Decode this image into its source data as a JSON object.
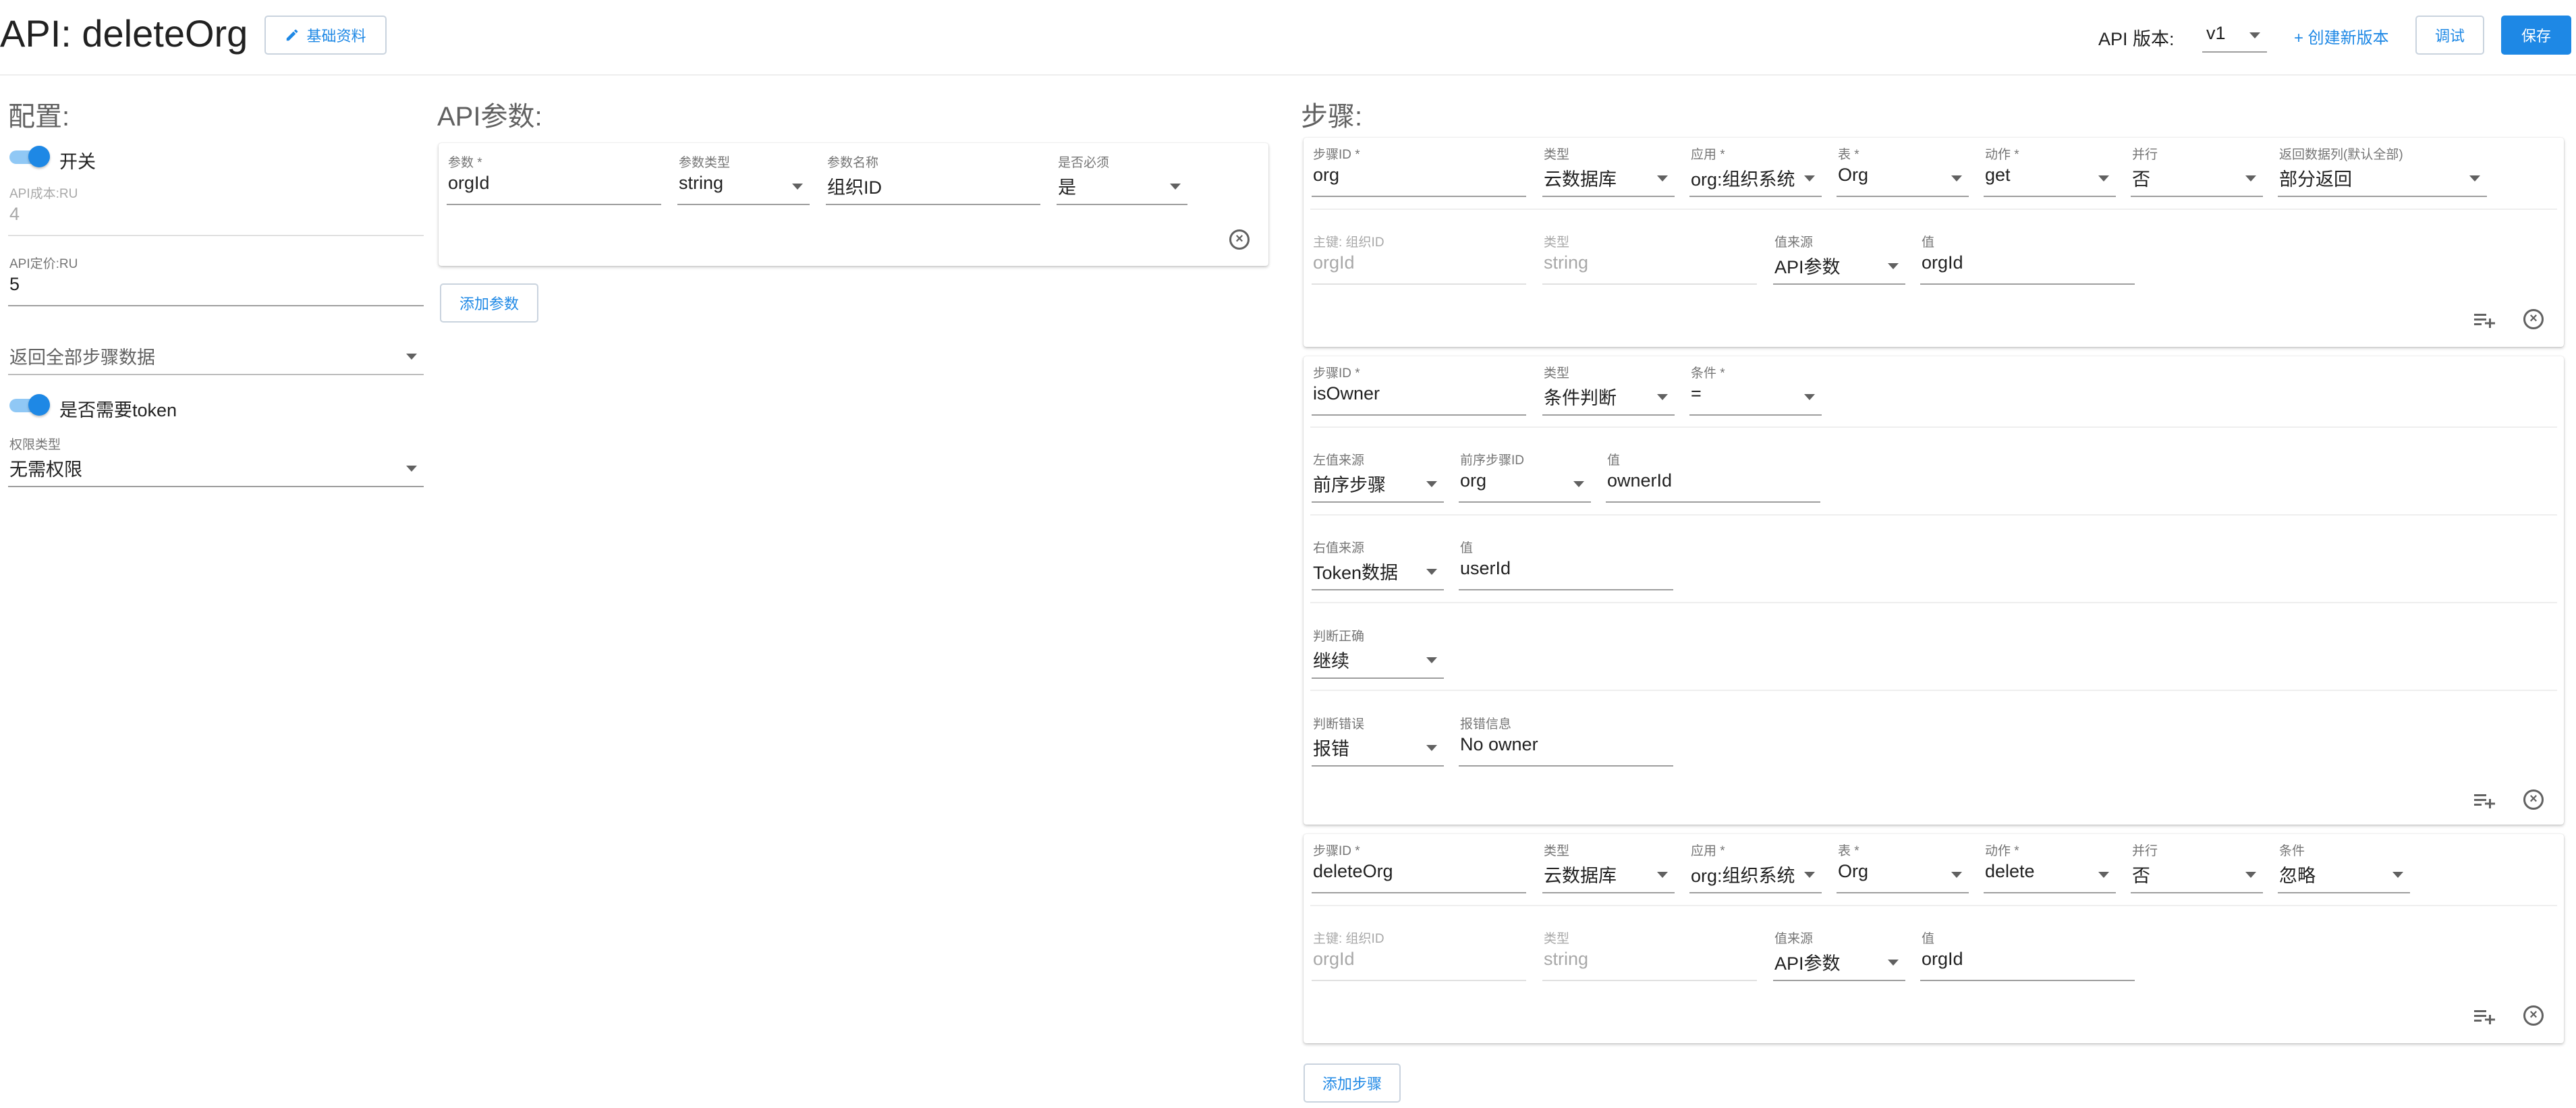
{
  "header": {
    "title": "API: deleteOrg",
    "edit_button": "基础资料",
    "version_label": "API 版本:",
    "version_value": "v1",
    "create_version": "+ 创建新版本",
    "debug_button": "调试",
    "save_button": "保存"
  },
  "config": {
    "title": "配置:",
    "switch_label": "开关",
    "cost_label": "API成本:RU",
    "cost_value": "4",
    "price_label": "API定价:RU",
    "price_value": "5",
    "return_select": "返回全部步骤数据",
    "token_label": "是否需要token",
    "perm_label": "权限类型",
    "perm_value": "无需权限"
  },
  "params": {
    "title": "API参数:",
    "headers": {
      "name": "参数 *",
      "type": "参数类型",
      "label": "参数名称",
      "required": "是否必须"
    },
    "rows": [
      {
        "name": "orgId",
        "type": "string",
        "label": "组织ID",
        "required": "是"
      }
    ],
    "add_button": "添加参数"
  },
  "steps": {
    "title": "步骤:",
    "step1": {
      "labels": {
        "id": "步骤ID *",
        "type": "类型",
        "app": "应用 *",
        "table": "表 *",
        "action": "动作 *",
        "parallel": "并行",
        "columns": "返回数据列(默认全部)"
      },
      "values": {
        "id": "org",
        "type": "云数据库",
        "app": "org:组织系统",
        "table": "Org",
        "action": "get",
        "parallel": "否",
        "columns": "部分返回"
      },
      "key": {
        "key_label": "主键: 组织ID",
        "key_value": "orgId",
        "type_label": "类型",
        "type_value": "string",
        "source_label": "值来源",
        "source_value": "API参数",
        "value_label": "值",
        "value_value": "orgId"
      }
    },
    "step2": {
      "labels": {
        "id": "步骤ID *",
        "type": "类型",
        "cond": "条件 *"
      },
      "values": {
        "id": "isOwner",
        "type": "条件判断",
        "cond": "="
      },
      "left": {
        "source_label": "左值来源",
        "source_value": "前序步骤",
        "prev_label": "前序步骤ID",
        "prev_value": "org",
        "value_label": "值",
        "value_value": "ownerId"
      },
      "right": {
        "source_label": "右值来源",
        "source_value": "Token数据",
        "value_label": "值",
        "value_value": "userId"
      },
      "pass": {
        "label": "判断正确",
        "value": "继续"
      },
      "fail": {
        "label": "判断错误",
        "value": "报错",
        "msg_label": "报错信息",
        "msg_value": "No owner"
      }
    },
    "step3": {
      "labels": {
        "id": "步骤ID *",
        "type": "类型",
        "app": "应用 *",
        "table": "表 *",
        "action": "动作 *",
        "parallel": "并行",
        "cond": "条件"
      },
      "values": {
        "id": "deleteOrg",
        "type": "云数据库",
        "app": "org:组织系统",
        "table": "Org",
        "action": "delete",
        "parallel": "否",
        "cond": "忽略"
      },
      "key": {
        "key_label": "主键: 组织ID",
        "key_value": "orgId",
        "type_label": "类型",
        "type_value": "string",
        "source_label": "值来源",
        "source_value": "API参数",
        "value_label": "值",
        "value_value": "orgId"
      }
    },
    "add_button": "添加步骤"
  },
  "colors": {
    "primary": "#1e88e5",
    "toggle_track": "#90c8f5",
    "text": "#212121",
    "label": "#757575",
    "disabled": "#a8a8a8"
  }
}
